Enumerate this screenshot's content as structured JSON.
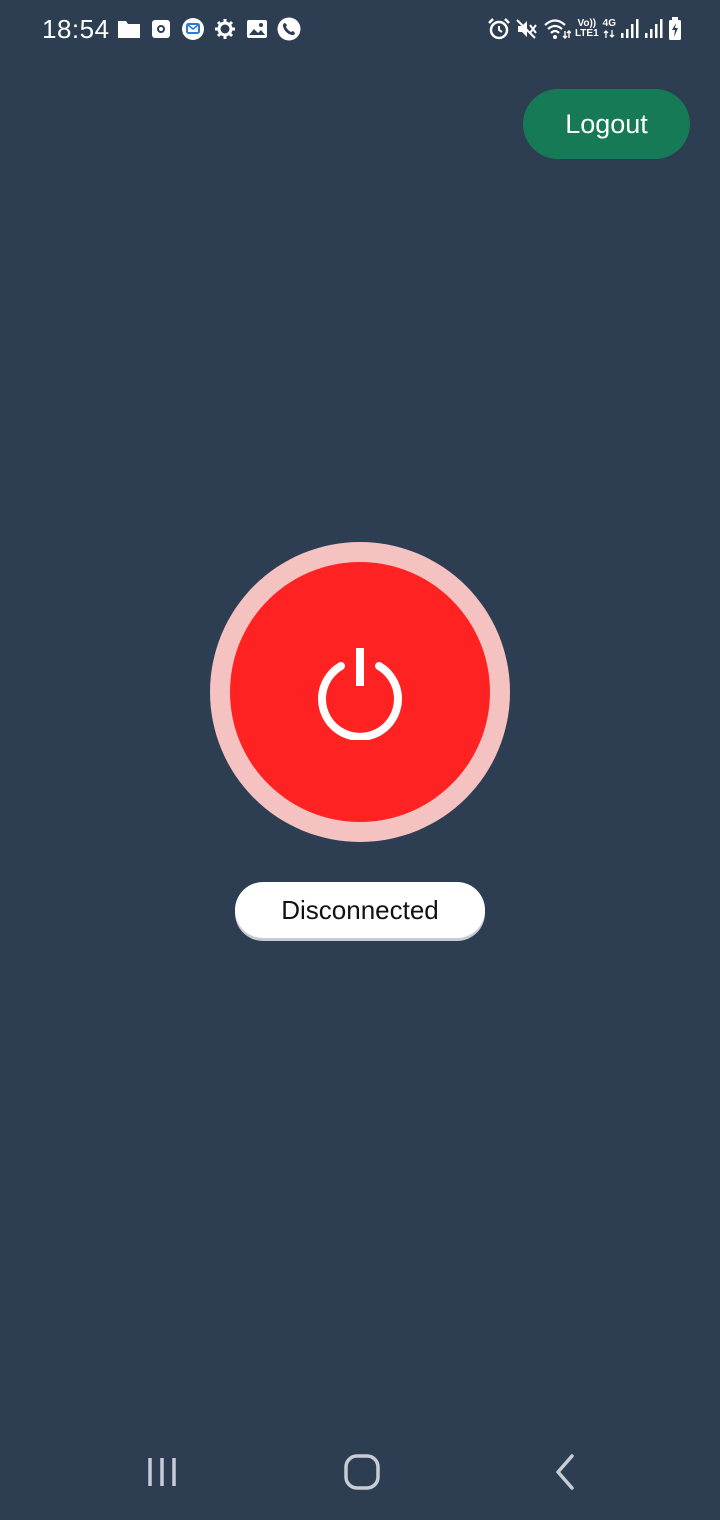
{
  "status_bar": {
    "time": "18:54",
    "volte_top": "Vo))",
    "volte_bottom": "LTE1",
    "network_label": "4G",
    "left_icons": [
      "folder-icon",
      "record-icon",
      "message-icon",
      "settings-icon",
      "image-icon",
      "phone-icon"
    ],
    "right_icons": [
      "alarm-icon",
      "mute-icon",
      "wifi-icon",
      "volte-icon",
      "4g-icon",
      "signal-icon",
      "signal-icon",
      "battery-icon"
    ]
  },
  "header": {
    "logout_label": "Logout"
  },
  "vpn": {
    "status_text": "Disconnected",
    "colors": {
      "background": "#2d3d52",
      "button_inner": "#ff2222",
      "button_outer": "#f5c2c2",
      "logout": "#177a57"
    }
  },
  "nav_bar": {
    "items": [
      "recents-icon",
      "home-icon",
      "back-icon"
    ]
  }
}
